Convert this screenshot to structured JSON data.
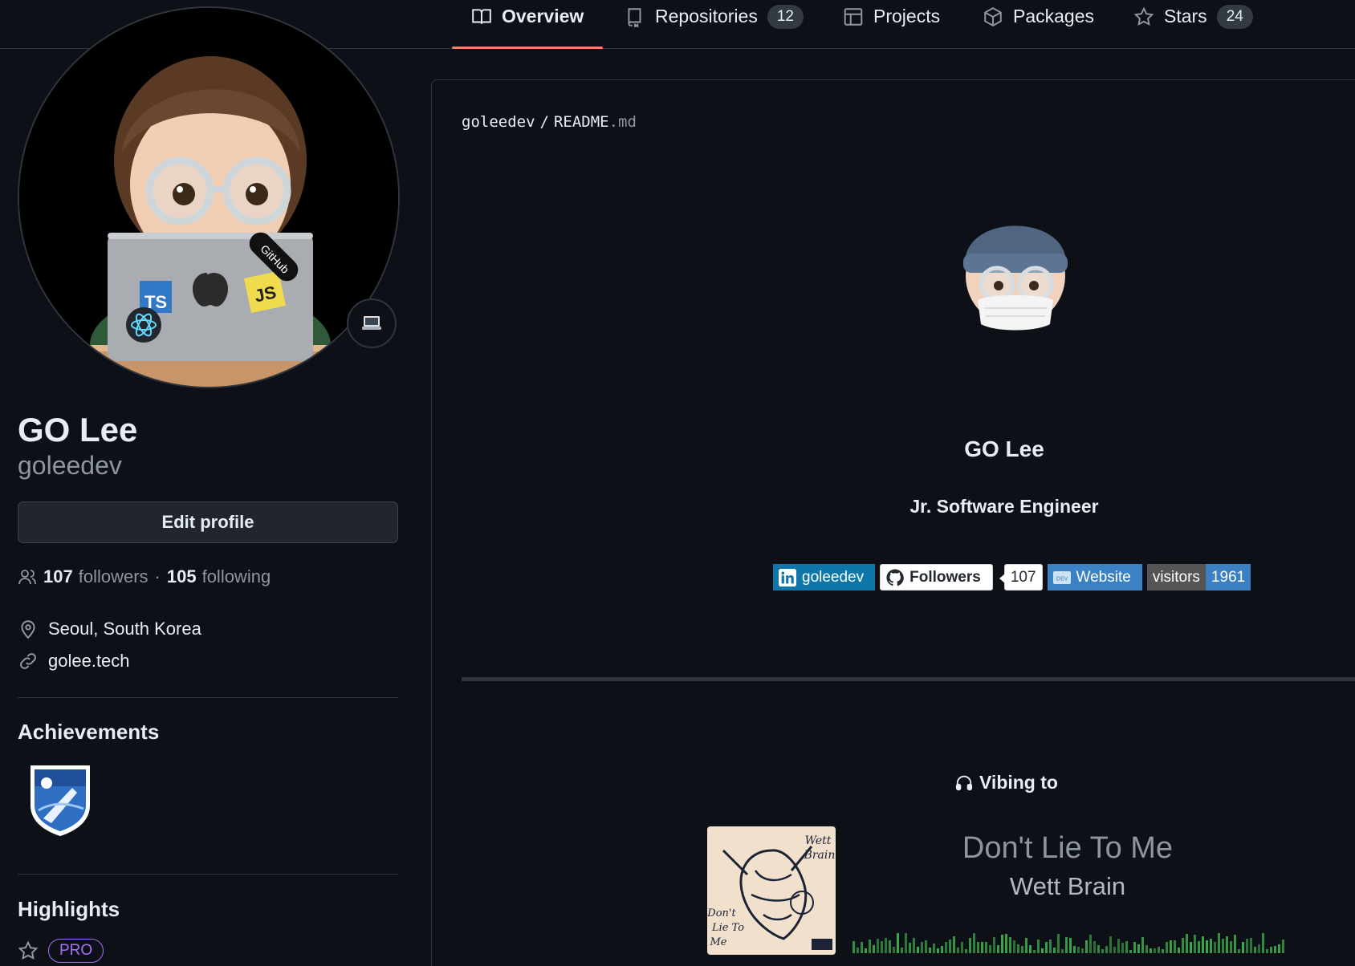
{
  "nav": {
    "tabs": [
      {
        "label": "Overview",
        "icon": "book-icon",
        "active": true
      },
      {
        "label": "Repositories",
        "icon": "repo-icon",
        "count": "12"
      },
      {
        "label": "Projects",
        "icon": "table-icon"
      },
      {
        "label": "Packages",
        "icon": "package-icon"
      },
      {
        "label": "Stars",
        "icon": "star-icon",
        "count": "24"
      }
    ]
  },
  "profile": {
    "name": "GO Lee",
    "login": "goleedev",
    "edit_label": "Edit profile",
    "followers_count": "107",
    "followers_label": "followers",
    "separator": "·",
    "following_count": "105",
    "following_label": "following",
    "location": "Seoul, South Korea",
    "website": "golee.tech",
    "avatar_stickers": {
      "ts": "TS",
      "js": "JS",
      "github": "GitHub"
    }
  },
  "achievements": {
    "title": "Achievements"
  },
  "highlights": {
    "title": "Highlights",
    "pro_label": "PRO"
  },
  "readme": {
    "owner": "goleedev",
    "slash": "/",
    "file": "README",
    "ext": ".md",
    "name": "GO Lee",
    "role": "Jr. Software Engineer",
    "badges": {
      "linkedin": "goleedev",
      "gh_followers_label": "Followers",
      "gh_followers_count": "107",
      "website": "Website",
      "visitors_label": "visitors",
      "visitors_count": "1961"
    },
    "vibing": {
      "heading": "Vibing to",
      "song": "Don't Lie To Me",
      "artist": "Wett Brain",
      "album_text": [
        "Wett",
        "Brain",
        "Don't",
        "Lie To",
        "Me"
      ]
    }
  },
  "colors": {
    "bg": "#0d1117",
    "border": "#30363d",
    "accent_underline": "#f78166",
    "pro": "#a371f7",
    "equalizer": "#3fb950"
  }
}
